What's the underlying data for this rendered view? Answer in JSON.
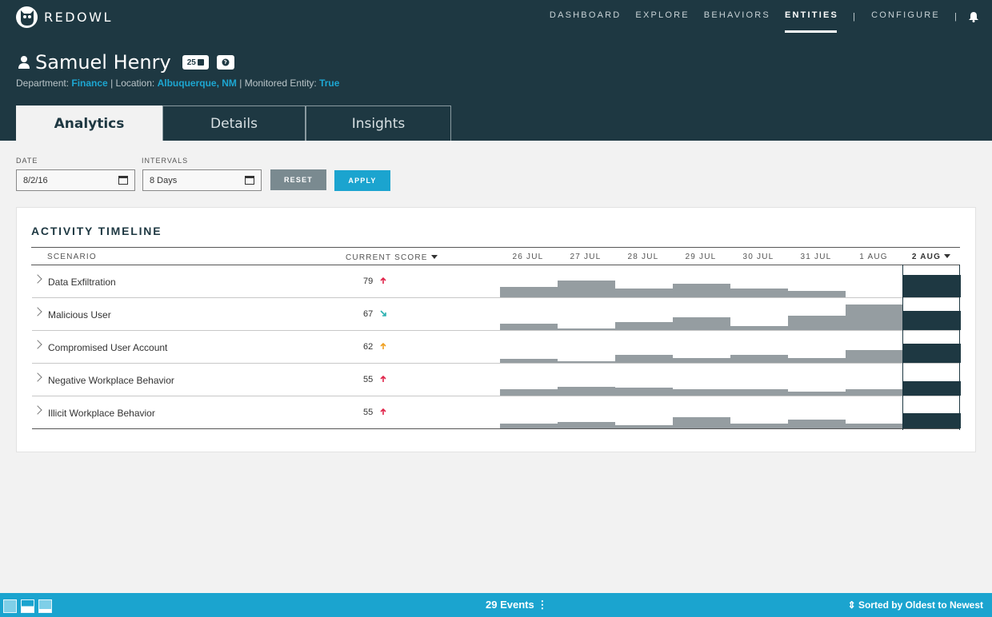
{
  "brand": {
    "name": "REDOWL"
  },
  "nav": {
    "items": [
      "DASHBOARD",
      "EXPLORE",
      "BEHAVIORS",
      "ENTITIES",
      "CONFIGURE"
    ],
    "active": "ENTITIES"
  },
  "entity": {
    "name": "Samuel Henry",
    "badge_count": "25",
    "department_label": "Department:",
    "department": "Finance",
    "location_label": "| Location:",
    "location": "Albuquerque, NM",
    "monitored_label": "| Monitored Entity:",
    "monitored": "True"
  },
  "tabs": [
    {
      "label": "Analytics",
      "active": true
    },
    {
      "label": "Details",
      "active": false
    },
    {
      "label": "Insights",
      "active": false
    }
  ],
  "filters": {
    "date_label": "DATE",
    "date_value": "8/2/16",
    "intervals_label": "INTERVALS",
    "intervals_value": "8 Days",
    "reset_label": "RESET",
    "apply_label": "APPLY"
  },
  "timeline": {
    "title": "ACTIVITY TIMELINE",
    "col_scenario": "SCENARIO",
    "col_score": "CURRENT SCORE",
    "dates": [
      "26 JUL",
      "27 JUL",
      "28 JUL",
      "29 JUL",
      "30 JUL",
      "31 JUL",
      "1 AUG",
      "2 AUG"
    ],
    "selected_date": "2 AUG",
    "rows": [
      {
        "scenario": "Data Exfiltration",
        "score": "79",
        "trend": "up",
        "trend_color": "#e0244a",
        "levels": [
          0.33,
          0.55,
          0.28,
          0.45,
          0.28,
          0.2,
          0.0,
          0.73
        ]
      },
      {
        "scenario": "Malicious User",
        "score": "67",
        "trend": "down",
        "trend_color": "#2ab0b0",
        "levels": [
          0.2,
          0.05,
          0.25,
          0.42,
          0.12,
          0.47,
          0.85,
          0.63
        ]
      },
      {
        "scenario": "Compromised User Account",
        "score": "62",
        "trend": "up",
        "trend_color": "#f0a020",
        "levels": [
          0.12,
          0.05,
          0.27,
          0.15,
          0.27,
          0.17,
          0.42,
          0.63
        ]
      },
      {
        "scenario": "Negative Workplace Behavior",
        "score": "55",
        "trend": "up",
        "trend_color": "#e0244a",
        "levels": [
          0.2,
          0.3,
          0.27,
          0.22,
          0.22,
          0.12,
          0.22,
          0.48
        ]
      },
      {
        "scenario": "Illicit Workplace Behavior",
        "score": "55",
        "trend": "up",
        "trend_color": "#e0244a",
        "levels": [
          0.15,
          0.22,
          0.1,
          0.37,
          0.17,
          0.3,
          0.17,
          0.5
        ]
      }
    ]
  },
  "footer": {
    "events": "29 Events",
    "sort": "Sorted by Oldest to Newest"
  },
  "colors": {
    "header": "#1e3842",
    "accent": "#1ba4cf",
    "bar": "#959da1"
  }
}
